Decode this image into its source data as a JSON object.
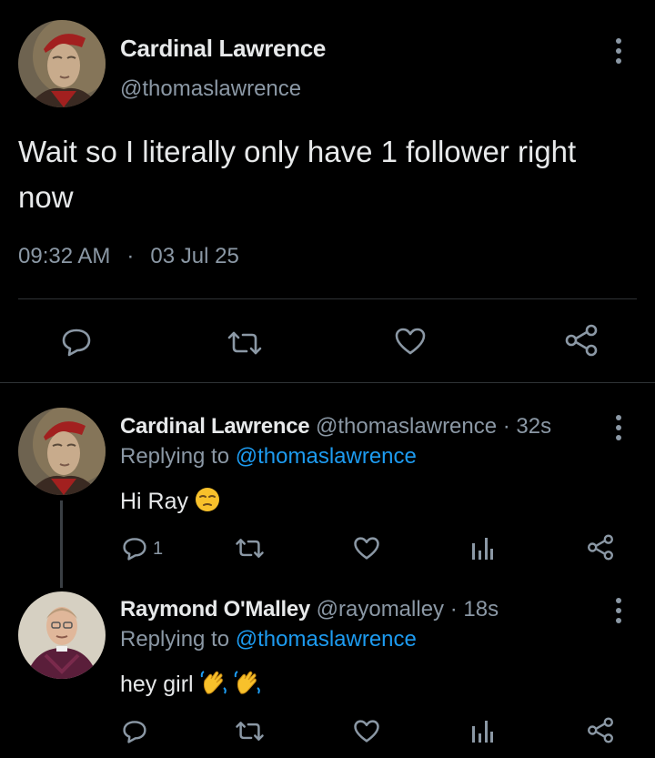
{
  "main_tweet": {
    "author_name": "Cardinal Lawrence",
    "handle": "@thomaslawrence",
    "text": "Wait so I literally only have 1 follower right now",
    "time": "09:32 AM",
    "separator": "·",
    "date": "03 Jul 25"
  },
  "replies": [
    {
      "author_name": "Cardinal Lawrence",
      "meta": "@thomaslawrence · 32s",
      "replying_prefix": "Replying to",
      "replying_handle": "@thomaslawrence",
      "text": "Hi Ray",
      "reply_count": "1"
    },
    {
      "author_name": "Raymond O'Malley",
      "meta": "@rayomalley · 18s",
      "replying_prefix": "Replying to",
      "replying_handle": "@thomaslawrence",
      "text": "hey girl"
    }
  ],
  "icons": {
    "more": "more-vertical-icon",
    "reply": "speech-bubble-icon",
    "retweet": "retweet-icon",
    "like": "heart-icon",
    "analytics": "bar-chart-icon",
    "share": "share-icon",
    "emoji_pensive": "pensive-face-emoji",
    "emoji_wave": "waving-hand-emoji"
  },
  "colors": {
    "background": "#000000",
    "text": "#e7e9ea",
    "muted": "#8b98a5",
    "link": "#1d9bf0",
    "divider": "#2f3336",
    "emoji_yellow": "#f8c12b"
  }
}
